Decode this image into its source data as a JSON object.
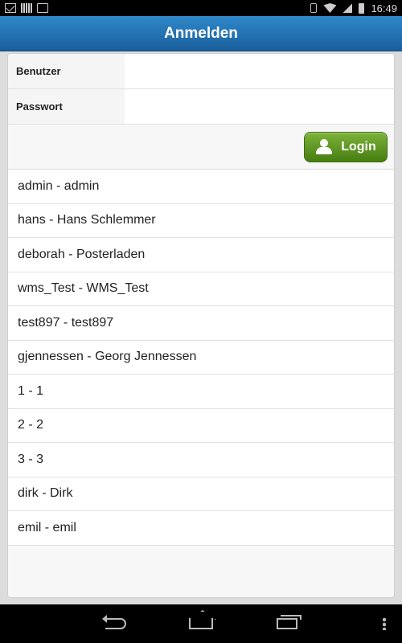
{
  "status_bar": {
    "time": "16:49",
    "left_icons": [
      "mail-icon",
      "barcode-icon",
      "clipboard-check-icon"
    ],
    "right_icons": [
      "bluetooth-icon",
      "wifi-icon",
      "signal-icon",
      "battery-icon"
    ]
  },
  "header": {
    "title": "Anmelden"
  },
  "form": {
    "username_label": "Benutzer",
    "username_value": "",
    "password_label": "Passwort",
    "password_value": "",
    "login_label": "Login"
  },
  "users": [
    "admin - admin",
    "hans - Hans Schlemmer",
    "deborah - Posterladen",
    "wms_Test - WMS_Test",
    "test897 - test897",
    "gjennessen - Georg Jennessen",
    "1 - 1",
    "2 - 2",
    "3 - 3",
    "dirk - Dirk",
    "emil - emil"
  ],
  "nav_icons": [
    "back-icon",
    "home-icon",
    "recent-apps-icon",
    "menu-icon"
  ],
  "colors": {
    "header": "#1a5f9c",
    "login_button": "#5b9622"
  }
}
